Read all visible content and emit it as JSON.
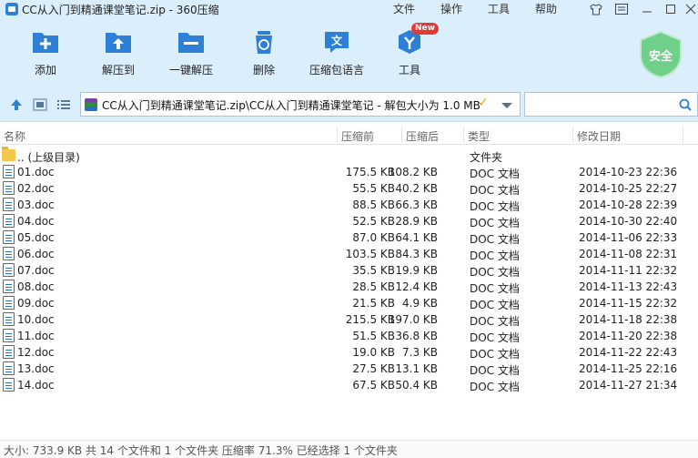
{
  "window": {
    "title": "CC从入门到精通课堂笔记.zip - 360压缩",
    "menu": [
      "文件",
      "操作",
      "工具",
      "帮助"
    ]
  },
  "toolbar": {
    "items": [
      {
        "label": "添加",
        "icon": "add-icon"
      },
      {
        "label": "解压到",
        "icon": "extract-to-icon"
      },
      {
        "label": "一键解压",
        "icon": "one-click-extract-icon"
      },
      {
        "label": "删除",
        "icon": "delete-icon"
      },
      {
        "label": "压缩包语言",
        "icon": "archive-language-icon"
      },
      {
        "label": "工具",
        "icon": "tools-icon"
      }
    ],
    "new_badge": "New",
    "security_label": "安全"
  },
  "address": {
    "path": "CC从入门到精通课堂笔记.zip\\CC从入门到精通课堂笔记 - 解包大小为 1.0 MB",
    "search_placeholder": ""
  },
  "columns": {
    "name": "名称",
    "original_size": "压缩前",
    "compressed_size": "压缩后",
    "type": "类型",
    "modified": "修改日期"
  },
  "parent_row": {
    "name": ".. (上级目录)",
    "type": "文件夹"
  },
  "files": [
    {
      "name": "01.doc",
      "original": "175.5 KB",
      "compressed": "108.2 KB",
      "type": "DOC 文档",
      "modified": "2014-10-23 22:36"
    },
    {
      "name": "02.doc",
      "original": "55.5 KB",
      "compressed": "40.2 KB",
      "type": "DOC 文档",
      "modified": "2014-10-25 22:27"
    },
    {
      "name": "03.doc",
      "original": "88.5 KB",
      "compressed": "66.3 KB",
      "type": "DOC 文档",
      "modified": "2014-10-28 22:39"
    },
    {
      "name": "04.doc",
      "original": "52.5 KB",
      "compressed": "28.9 KB",
      "type": "DOC 文档",
      "modified": "2014-10-30 22:40"
    },
    {
      "name": "05.doc",
      "original": "87.0 KB",
      "compressed": "64.1 KB",
      "type": "DOC 文档",
      "modified": "2014-11-06 22:33"
    },
    {
      "name": "06.doc",
      "original": "103.5 KB",
      "compressed": "84.3 KB",
      "type": "DOC 文档",
      "modified": "2014-11-08 22:31"
    },
    {
      "name": "07.doc",
      "original": "35.5 KB",
      "compressed": "19.9 KB",
      "type": "DOC 文档",
      "modified": "2014-11-11 22:32"
    },
    {
      "name": "08.doc",
      "original": "28.5 KB",
      "compressed": "12.4 KB",
      "type": "DOC 文档",
      "modified": "2014-11-13 22:43"
    },
    {
      "name": "09.doc",
      "original": "21.5 KB",
      "compressed": "4.9 KB",
      "type": "DOC 文档",
      "modified": "2014-11-15 22:32"
    },
    {
      "name": "10.doc",
      "original": "215.5 KB",
      "compressed": "197.0 KB",
      "type": "DOC 文档",
      "modified": "2014-11-18 22:38"
    },
    {
      "name": "11.doc",
      "original": "51.5 KB",
      "compressed": "36.8 KB",
      "type": "DOC 文档",
      "modified": "2014-11-20 22:38"
    },
    {
      "name": "12.doc",
      "original": "19.0 KB",
      "compressed": "7.3 KB",
      "type": "DOC 文档",
      "modified": "2014-11-22 22:43"
    },
    {
      "name": "13.doc",
      "original": "27.5 KB",
      "compressed": "13.1 KB",
      "type": "DOC 文档",
      "modified": "2014-11-25 22:16"
    },
    {
      "name": "14.doc",
      "original": "67.5 KB",
      "compressed": "50.4 KB",
      "type": "DOC 文档",
      "modified": "2014-11-27 21:34"
    }
  ],
  "status": "大小: 733.9 KB 共 14 个文件和 1 个文件夹 压缩率 71.3% 已经选择 1 个文件夹",
  "colors": {
    "accent": "#2e7fd6",
    "toolbar_bg": "#dbeefc",
    "security": "#6fd08a"
  }
}
